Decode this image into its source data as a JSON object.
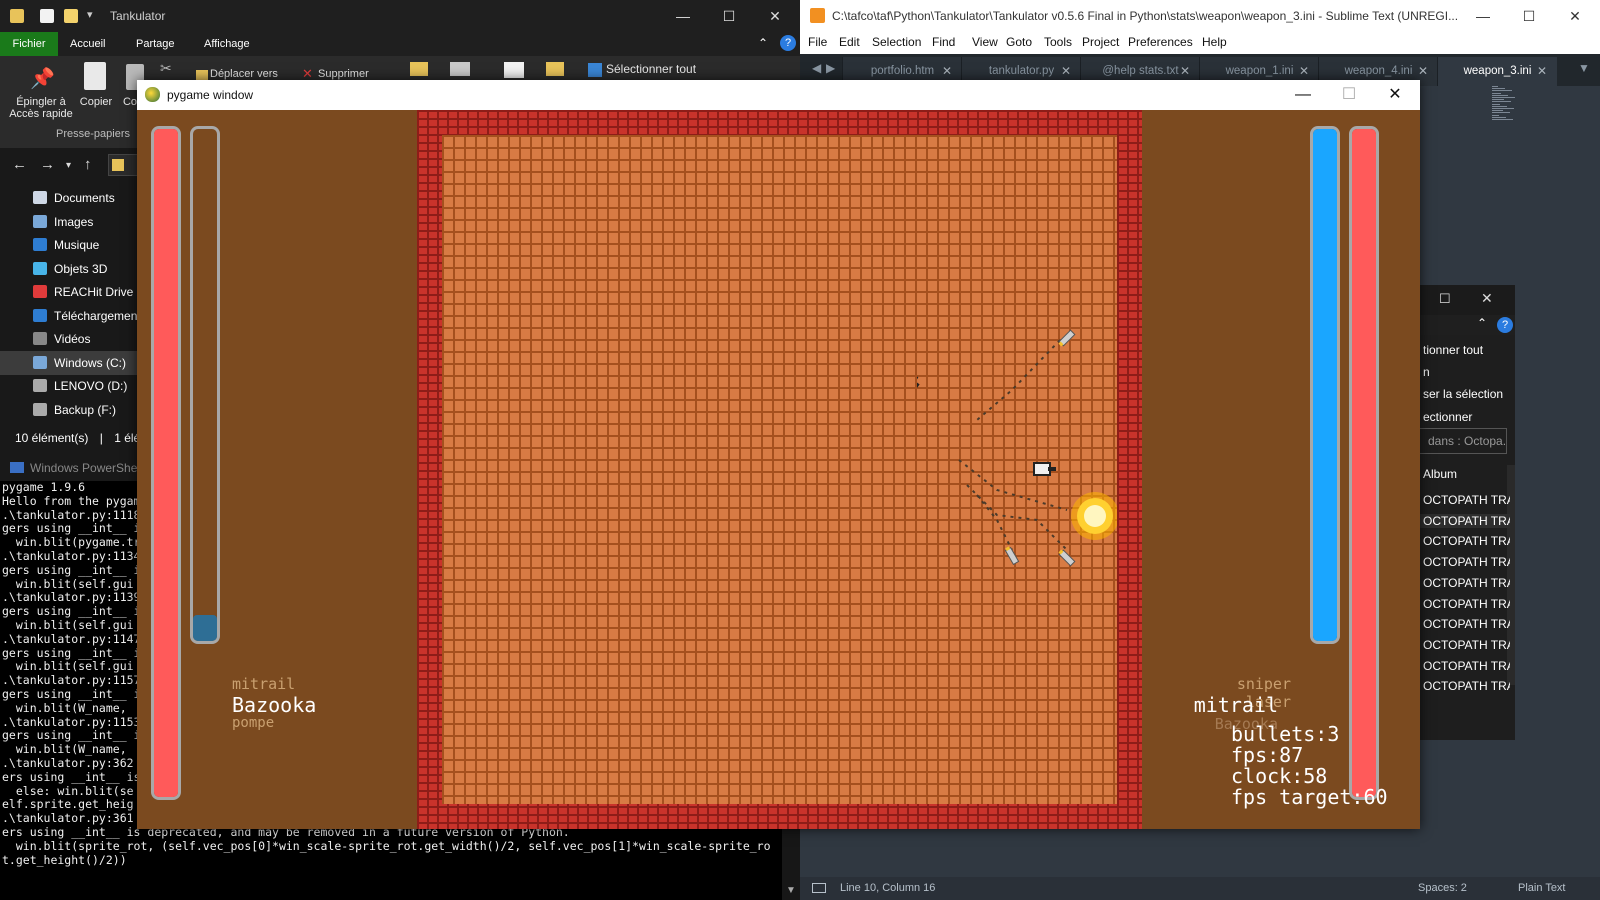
{
  "explorer": {
    "title": "Tankulator",
    "tabs": [
      "Fichier",
      "Accueil",
      "Partage",
      "Affichage"
    ],
    "ribbon": {
      "pin_label_1": "Épingler à",
      "pin_label_2": "Accès rapide",
      "copy_label": "Copier",
      "paste_label": "Co",
      "move_label": "Déplacer vers",
      "delete_label": "Supprimer",
      "select_all_label": "Sélectionner tout",
      "group_label": "Presse-papiers"
    },
    "tree": [
      {
        "label": "Documents",
        "icon": "documents-icon",
        "color": "#cfd8e6"
      },
      {
        "label": "Images",
        "icon": "images-icon",
        "color": "#7aa8d8"
      },
      {
        "label": "Musique",
        "icon": "music-icon",
        "color": "#2e7dd2"
      },
      {
        "label": "Objets 3D",
        "icon": "objects3d-icon",
        "color": "#48b4e8"
      },
      {
        "label": "REACHit Drive",
        "icon": "reachit-icon",
        "color": "#e03b3b"
      },
      {
        "label": "Téléchargements",
        "icon": "download-icon",
        "color": "#2e7dd2"
      },
      {
        "label": "Vidéos",
        "icon": "videos-icon",
        "color": "#888888"
      },
      {
        "label": "Windows (C:)",
        "icon": "drive-c-icon",
        "color": "#7aa8d8"
      },
      {
        "label": "LENOVO (D:)",
        "icon": "drive-d-icon",
        "color": "#aaaaaa"
      },
      {
        "label": "Backup (F:)",
        "icon": "drive-f-icon",
        "color": "#aaaaaa"
      }
    ],
    "selected_tree_index": 7,
    "status_count": "10 élément(s)",
    "status_sel": "1 élém"
  },
  "powershell": {
    "title": "Windows PowerShell",
    "lines": [
      "pygame 1.9.6",
      "Hello from the pygame",
      ".\\tankulator.py:1118",
      "gers using __int__ i",
      "  win.blit(pygame.tr",
      ".\\tankulator.py:1134",
      "gers using __int__ i",
      "  win.blit(self.gui",
      ".\\tankulator.py:1139",
      "gers using __int__ i",
      "  win.blit(self.gui",
      ".\\tankulator.py:1147",
      "gers using __int__ i",
      "  win.blit(self.gui",
      ".\\tankulator.py:1157",
      "gers using __int__ i",
      "  win.blit(W_name,",
      ".\\tankulator.py:1153",
      "gers using __int__ i",
      "  win.blit(W_name,",
      ".\\tankulator.py:362",
      "ers using __int__ is",
      "  else: win.blit(se",
      "elf.sprite.get_heig",
      ".\\tankulator.py:361",
      "ers using __int__ is deprecated, and may be removed in a future version of Python.",
      "  win.blit(sprite_rot, (self.vec_pos[0]*win_scale-sprite_rot.get_width()/2, self.vec_pos[1]*win_scale-sprite_ro",
      "t.get_height()/2))"
    ]
  },
  "sublime": {
    "title": "C:\\tafco\\taf\\Python\\Tankulator\\Tankulator v0.5.6 Final in Python\\stats\\weapon\\weapon_3.ini - Sublime Text (UNREGI...",
    "menu": [
      "File",
      "Edit",
      "Selection",
      "Find",
      "View",
      "Goto",
      "Tools",
      "Project",
      "Preferences",
      "Help"
    ],
    "tabs": [
      "portfolio.htm",
      "tankulator.py",
      "@help stats.txt",
      "weapon_1.ini",
      "weapon_4.ini",
      "weapon_3.ini"
    ],
    "active_tab": 5,
    "status_pos": "Line 10, Column 16",
    "status_spaces": "Spaces: 2",
    "status_syntax": "Plain Text"
  },
  "media": {
    "select_all": "tionner tout",
    "n": "n",
    "invert": "ser la sélection",
    "select": "ectionner",
    "search": "dans : Octopa...",
    "album_header": "Album",
    "rows": [
      "OCTOPATH TRA",
      "OCTOPATH TRA",
      "OCTOPATH TRA",
      "OCTOPATH TRA",
      "OCTOPATH TRA",
      "OCTOPATH TRA",
      "OCTOPATH TRA",
      "OCTOPATH TRA",
      "OCTOPATH TRA",
      "OCTOPATH TRA"
    ]
  },
  "pygame": {
    "title": "pygame window",
    "colors": {
      "health": "#ff5a5a",
      "shield": "#1aa6ff",
      "ammo": "#2e6e95",
      "bg": "#7b4a1f"
    },
    "player1": {
      "health_level": 1.0,
      "ammo_level": 0.05,
      "weapon_prev": "mitrail",
      "weapon_current": "Bazooka",
      "weapon_next": "pompe"
    },
    "player2": {
      "shield_level": 1.0,
      "health_level": 1.0,
      "weapon_prev": "sniper laser",
      "weapon_current": "mitrail",
      "weapon_next": "Bazooka"
    },
    "stats": {
      "bullets": "bullets:3",
      "fps": "fps:87",
      "clock": "clock:58",
      "fps_target": "fps target:60"
    }
  }
}
